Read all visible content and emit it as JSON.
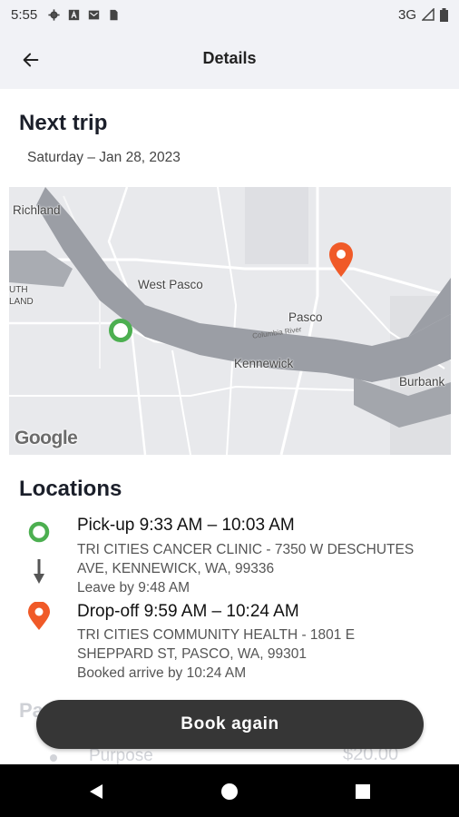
{
  "status_bar": {
    "time": "5:55",
    "network": "3G",
    "icons": [
      "gear-icon",
      "a-box-icon",
      "mail-box-icon",
      "sim-card-icon",
      "signal-icon",
      "battery-icon"
    ]
  },
  "app_bar": {
    "title": "Details",
    "back_icon": "arrow-left-icon"
  },
  "trip": {
    "heading": "Next trip",
    "date": "Saturday – Jan 28, 2023"
  },
  "map": {
    "labels": {
      "richland": "Richland",
      "west_pasco": "West Pasco",
      "pasco": "Pasco",
      "kennewick": "Kennewick",
      "burbank": "Burbank",
      "south_land_1": "UTH",
      "south_land_2": "LAND",
      "river": "Columbia River"
    },
    "attribution": "Google",
    "pickup_marker_color": "#4caf50",
    "dropoff_marker_color": "#f05a28"
  },
  "locations": {
    "heading": "Locations",
    "pickup": {
      "title": "Pick-up 9:33 AM – 10:03 AM",
      "address_line1": "TRI CITIES CANCER CLINIC - 7350 W DESCHUTES",
      "address_line2": "AVE, KENNEWICK, WA, 99336",
      "note": "Leave by 9:48 AM"
    },
    "dropoff": {
      "title": "Drop-off 9:59 AM – 10:24 AM",
      "address_line1": "TRI CITIES COMMUNITY HEALTH - 1801 E",
      "address_line2": "SHEPPARD ST, PASCO, WA, 99301",
      "note": "Booked arrive by 10:24 AM"
    }
  },
  "behind_button": {
    "section_start": "Pa",
    "purpose": "Purpose",
    "price": "$20.00"
  },
  "book_again_label": "Book again",
  "nav_bar": {
    "icons": [
      "back-triangle-icon",
      "home-circle-icon",
      "recents-square-icon"
    ]
  }
}
